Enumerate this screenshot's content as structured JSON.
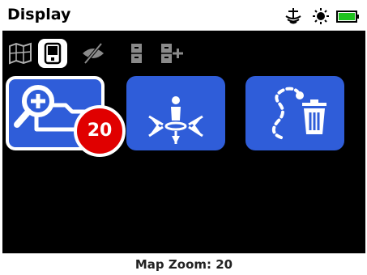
{
  "header": {
    "title": "Display",
    "status_icons": [
      "detector-signal-icon",
      "sun-brightness-icon",
      "battery-icon"
    ],
    "battery_color": "#1fc21f"
  },
  "tabs": [
    {
      "name": "tab-map",
      "icon": "map-icon",
      "selected": false
    },
    {
      "name": "tab-display",
      "icon": "device-icon",
      "selected": true
    },
    {
      "name": "tab-hide",
      "icon": "eye-hidden-icon",
      "selected": false
    },
    {
      "name": "tab-storage",
      "icon": "file-cabinet-icon",
      "selected": false
    },
    {
      "name": "tab-storage-add",
      "icon": "file-cabinet-add-icon",
      "selected": false
    }
  ],
  "tiles": [
    {
      "name": "map-zoom-tile",
      "icon": "zoom-in-map-icon",
      "selected": true,
      "badge": "20"
    },
    {
      "name": "center-position-tile",
      "icon": "person-center-icon",
      "selected": false
    },
    {
      "name": "clear-trail-tile",
      "icon": "trail-delete-icon",
      "selected": false
    }
  ],
  "colors": {
    "tile": "#2f5dd9",
    "badge": "#e00000",
    "background": "#000000"
  },
  "footer": {
    "label": "Map Zoom: 20"
  }
}
